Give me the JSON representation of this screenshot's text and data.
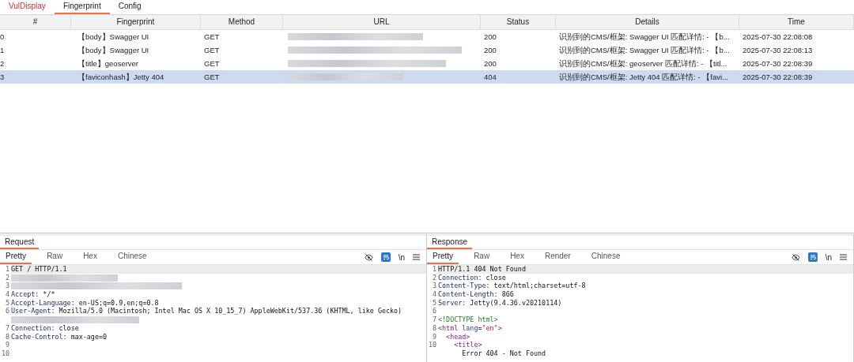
{
  "tabs": [
    {
      "label": "VulDisplay",
      "selected": false,
      "kind": "alert"
    },
    {
      "label": "Fingerprint",
      "selected": true,
      "kind": "normal"
    },
    {
      "label": "Config",
      "selected": false,
      "kind": "normal"
    }
  ],
  "table": {
    "columns": [
      "#",
      "Fingerprint",
      "Method",
      "URL",
      "Status",
      "Details",
      "Time"
    ],
    "rows": [
      {
        "selected": false,
        "cells": [
          "0",
          "【body】Swagger UI",
          "GET",
          null,
          "200",
          "识别到的CMS/框架: Swagger UI  匹配详情: - 【b...",
          "2025-07-30 22:08:08"
        ]
      },
      {
        "selected": false,
        "cells": [
          "1",
          "【body】Swagger UI",
          "GET",
          null,
          "200",
          "识别到的CMS/框架: Swagger UI  匹配详情: - 【b...",
          "2025-07-30 22:08:13"
        ]
      },
      {
        "selected": false,
        "cells": [
          "2",
          "【title】geoserver",
          "GET",
          null,
          "200",
          "识别到的CMS/框架: geoserver  匹配详情: - 【titl...",
          "2025-07-30 22:08:39"
        ]
      },
      {
        "selected": true,
        "cells": [
          "3",
          "【faviconhash】Jetty 404",
          "GET",
          null,
          "404",
          "识别到的CMS/框架: Jetty 404  匹配详情: - 【favi...",
          "2025-07-30 22:08:39"
        ]
      }
    ]
  },
  "panels": [
    {
      "title": "Request",
      "views": [
        {
          "label": "Pretty",
          "selected": true
        },
        {
          "label": "Raw",
          "selected": false
        },
        {
          "label": "Hex",
          "selected": false
        },
        {
          "label": "Chinese",
          "selected": false
        }
      ],
      "newline_label": "\\n",
      "lines": [
        {
          "n": "1",
          "highlighted": true,
          "segments": [
            {
              "kind": "plain",
              "text": "GET / HTTP/1.1"
            }
          ]
        },
        {
          "n": "2",
          "highlighted": false,
          "kind": "redacted"
        },
        {
          "n": "3",
          "highlighted": false,
          "kind": "redacted"
        },
        {
          "n": "4",
          "highlighted": false,
          "segments": [
            {
              "kind": "name",
              "text": "Accept:"
            },
            {
              "kind": "plain",
              "text": " */*"
            }
          ]
        },
        {
          "n": "5",
          "highlighted": false,
          "segments": [
            {
              "kind": "name",
              "text": "Accept-Language:"
            },
            {
              "kind": "plain",
              "text": " en-US;q=0.9,en;q=0.8"
            }
          ]
        },
        {
          "n": "6",
          "highlighted": false,
          "segments": [
            {
              "kind": "name",
              "text": "User-Agent:"
            },
            {
              "kind": "plain",
              "text": " Mozilla/5.0 (Macintosh; Intel Mac OS X 10_15_7) AppleWebKit/537.36 (KHTML, like Gecko)"
            }
          ]
        },
        {
          "highlighted": false,
          "kind": "redacted"
        },
        {
          "n": "7",
          "highlighted": false,
          "segments": [
            {
              "kind": "name",
              "text": "Connection:"
            },
            {
              "kind": "plain",
              "text": " close"
            }
          ]
        },
        {
          "n": "8",
          "highlighted": false,
          "segments": [
            {
              "kind": "name",
              "text": "Cache-Control:"
            },
            {
              "kind": "plain",
              "text": " max-age=0"
            }
          ]
        },
        {
          "n": "9",
          "highlighted": false
        },
        {
          "n": "10",
          "highlighted": false
        }
      ]
    },
    {
      "title": "Response",
      "views": [
        {
          "label": "Pretty",
          "selected": true
        },
        {
          "label": "Raw",
          "selected": false
        },
        {
          "label": "Hex",
          "selected": false
        },
        {
          "label": "Render",
          "selected": false
        },
        {
          "label": "Chinese",
          "selected": false
        }
      ],
      "newline_label": "\\n",
      "lines": [
        {
          "n": "1",
          "highlighted": true,
          "segments": [
            {
              "kind": "plain",
              "text": "HTTP/1.1 404 Not Found"
            }
          ]
        },
        {
          "n": "2",
          "highlighted": false,
          "segments": [
            {
              "kind": "name",
              "text": "Connection:"
            },
            {
              "kind": "plain",
              "text": " close"
            }
          ]
        },
        {
          "n": "3",
          "highlighted": false,
          "segments": [
            {
              "kind": "name",
              "text": "Content-Type:"
            },
            {
              "kind": "plain",
              "text": " text/html;charset=utf-8"
            }
          ]
        },
        {
          "n": "4",
          "highlighted": false,
          "segments": [
            {
              "kind": "name",
              "text": "Content-Length:"
            },
            {
              "kind": "plain",
              "text": " 866"
            }
          ]
        },
        {
          "n": "5",
          "highlighted": false,
          "segments": [
            {
              "kind": "name",
              "text": "Server:"
            },
            {
              "kind": "plain",
              "text": " Jetty(9.4.36.v20210114)"
            }
          ]
        },
        {
          "n": "6",
          "highlighted": false
        },
        {
          "n": "7",
          "highlighted": false,
          "segments": [
            {
              "kind": "doctype",
              "text": "<!DOCTYPE html>"
            }
          ]
        },
        {
          "n": "8",
          "highlighted": false,
          "segments": [
            {
              "kind": "tag",
              "text": "<html"
            },
            {
              "kind": "attr",
              "text": " lang"
            },
            {
              "kind": "plain",
              "text": "="
            },
            {
              "kind": "string",
              "text": "\"en\""
            },
            {
              "kind": "tag",
              "text": ">"
            }
          ]
        },
        {
          "n": "9",
          "highlighted": false,
          "segments": [
            {
              "kind": "tag",
              "text": "  <head>"
            }
          ]
        },
        {
          "n": "10",
          "highlighted": false,
          "segments": [
            {
              "kind": "tag",
              "text": "    <title>"
            }
          ]
        },
        {
          "highlighted": false,
          "segments": [
            {
              "kind": "plain",
              "text": "      Error 404 - Not Found"
            }
          ]
        }
      ]
    }
  ]
}
